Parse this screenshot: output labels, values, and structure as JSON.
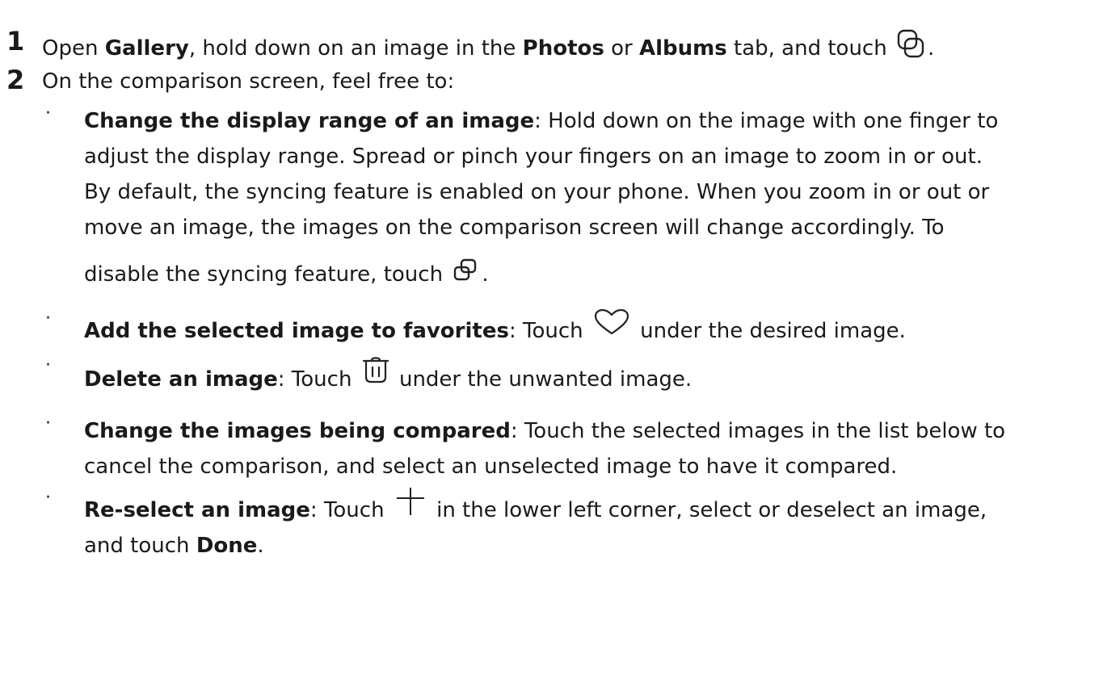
{
  "step1": {
    "number": "1",
    "t1": "Open ",
    "b1": "Gallery",
    "t2": ", hold down on an image in the ",
    "b2": "Photos",
    "t3": " or ",
    "b3": "Albums",
    "t4": " tab, and touch ",
    "t5": ".",
    "icon": "compare-icon"
  },
  "step2": {
    "number": "2",
    "text": "On the comparison screen, feel free to:"
  },
  "bullets": {
    "display_range": {
      "bold": "Change the display range of an image",
      "line1": ": Hold down on the image with one finger to",
      "line2": "adjust the display range. Spread or pinch your fingers on an image to zoom in or out.",
      "line3": "By default, the syncing feature is enabled on your phone. When you zoom in or out or",
      "line4": "move an image, the images on the comparison screen will change accordingly. To",
      "line5": "disable the syncing feature, touch ",
      "line5_end": ".",
      "icon": "sync-icon"
    },
    "favorites": {
      "bold": "Add the selected image to favorites",
      "t1": ": Touch ",
      "t2": " under the desired image.",
      "icon": "heart-icon"
    },
    "delete": {
      "bold": "Delete an image",
      "t1": ": Touch ",
      "t2": " under the unwanted image.",
      "icon": "trash-icon"
    },
    "change": {
      "bold": "Change the images being compared",
      "line1": ": Touch the selected images in the list below to",
      "line2": "cancel the comparison, and select an unselected image to have it compared."
    },
    "reselect": {
      "bold": "Re-select an image",
      "t1": ": Touch ",
      "t2": " in the lower left corner, select or deselect an image,",
      "line2a": "and touch ",
      "line2b": "Done",
      "line2c": ".",
      "icon": "plus-icon"
    },
    "dot": "·"
  }
}
